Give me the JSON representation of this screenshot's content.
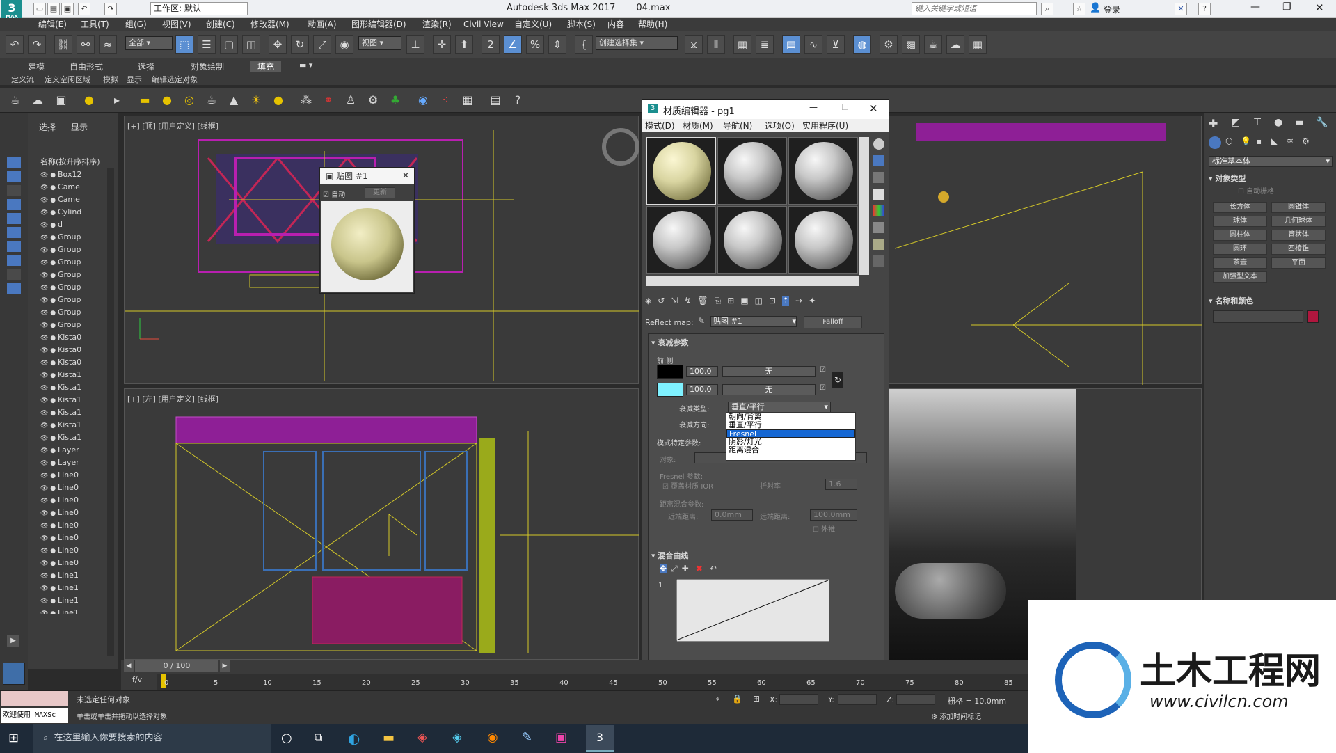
{
  "titlebar": {
    "app_title": "Autodesk 3ds Max 2017",
    "file": "04.max",
    "workspace_label": "工作区: 默认",
    "search_placeholder": "键入关键字或短语",
    "login": "登录",
    "logo_text": "MAX"
  },
  "menus": [
    "编辑(E)",
    "工具(T)",
    "组(G)",
    "视图(V)",
    "创建(C)",
    "修改器(M)",
    "动画(A)",
    "图形编辑器(D)",
    "渲染(R)",
    "Civil View",
    "自定义(U)",
    "脚本(S)",
    "内容",
    "帮助(H)"
  ],
  "toolbar": {
    "filter_select": "全部",
    "view_select": "视图",
    "named_set": "创建选择集"
  },
  "ribbon": {
    "tabs": [
      "建模",
      "自由形式",
      "选择",
      "对象绘制",
      "填充"
    ],
    "active_tab": "填充",
    "subtabs": [
      "定义流",
      "定义空闲区域",
      "模拟",
      "显示",
      "编辑选定对象"
    ]
  },
  "scene_explorer": {
    "tabs": [
      "选择",
      "显示"
    ],
    "header": "名称(按升序排序)",
    "items": [
      "Box12",
      "Came",
      "Came",
      "Cylind",
      "d",
      "Group",
      "Group",
      "Group",
      "Group",
      "Group",
      "Group",
      "Group",
      "Group",
      "Kista0",
      "Kista0",
      "Kista0",
      "Kista1",
      "Kista1",
      "Kista1",
      "Kista1",
      "Kista1",
      "Kista1",
      "Layer",
      "Layer",
      "Line0",
      "Line0",
      "Line0",
      "Line0",
      "Line0",
      "Line0",
      "Line0",
      "Line0",
      "Line1",
      "Line1",
      "Line1",
      "Line1"
    ]
  },
  "viewports": {
    "top_label": "[+] [顶] [用户定义] [线框]",
    "left_label": "[+] [左] [用户定义] [线框]"
  },
  "map_window": {
    "title": "贴图 #1",
    "auto_label": "自动",
    "update_label": "更新"
  },
  "material_editor": {
    "title": "材质编辑器 - pg1",
    "menus": [
      "模式(D)",
      "材质(M)",
      "导航(N)",
      "选项(O)",
      "实用程序(U)"
    ],
    "reflect_label": "Reflect map:",
    "map_name": "贴图 #1",
    "map_type": "Falloff",
    "falloff_params_title": "衰减参数",
    "front_side_label": "前:侧",
    "value1": "100.0",
    "value2": "100.0",
    "none1": "无",
    "none2": "无",
    "falloff_type_label": "衰减类型:",
    "falloff_type_value": "垂直/平行",
    "falloff_dir_label": "衰减方向:",
    "mode_params_label": "模式特定参数:",
    "object_label": "对象:",
    "object_value": "无",
    "fresnel_params": "Fresnel 参数:",
    "override_ior": "覆盖材质 IOR",
    "ior_label": "折射率",
    "ior_value": "1.6",
    "dist_blend": "距离混合参数:",
    "near_label": "近端距离:",
    "near_value": "0.0mm",
    "far_label": "远端距离:",
    "far_value": "100.0mm",
    "extrapolate": "外推",
    "mix_curve_title": "混合曲线",
    "curve_index": "1",
    "dropdown_options": [
      "朝向/背离",
      "垂直/平行",
      "Fresnel",
      "阴影/灯光",
      "距离混合"
    ],
    "dropdown_selected": "Fresnel"
  },
  "command_panel": {
    "category_select": "标准基本体",
    "object_type_title": "对象类型",
    "autogrid": "自动栅格",
    "buttons": [
      "长方体",
      "圆锥体",
      "球体",
      "几何球体",
      "圆柱体",
      "管状体",
      "圆环",
      "四棱锥",
      "茶壶",
      "平面",
      "加强型文本"
    ],
    "name_color_title": "名称和颜色",
    "swatch_color": "#b0163e"
  },
  "timeline": {
    "frame_counter": "0 / 100",
    "ticks": [
      "0",
      "5",
      "10",
      "15",
      "20",
      "25",
      "30",
      "35",
      "40",
      "45",
      "50",
      "55",
      "60",
      "65",
      "70",
      "75",
      "80",
      "85"
    ]
  },
  "status": {
    "welcome": "欢迎使用 MAXSc",
    "no_selection": "未选定任何对象",
    "hint": "单击或单击并拖动以选择对象",
    "x_label": "X:",
    "y_label": "Y:",
    "z_label": "Z:",
    "grid": "栅格 = 10.0mm",
    "add_time_tag": "添加时间标记"
  },
  "taskbar": {
    "search_placeholder": "在这里输入你要搜索的内容"
  },
  "watermark": {
    "cn": "土木工程网",
    "url": "www.civilcn.com"
  }
}
